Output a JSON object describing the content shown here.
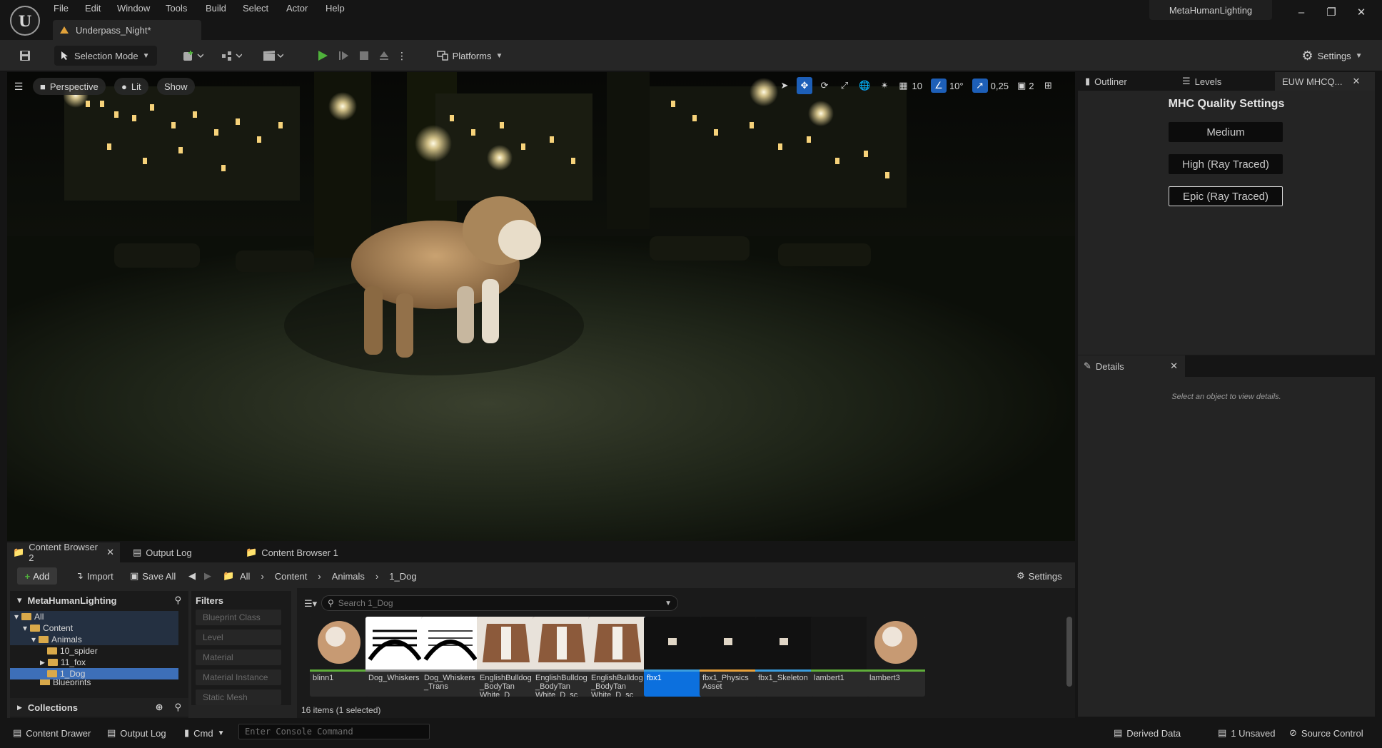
{
  "menu": [
    "File",
    "Edit",
    "Window",
    "Tools",
    "Build",
    "Select",
    "Actor",
    "Help"
  ],
  "doc_tab": {
    "title": "Underpass_Night*"
  },
  "project_name": "MetaHumanLighting",
  "toolbar": {
    "selection_mode": "Selection Mode",
    "platforms": "Platforms",
    "settings": "Settings"
  },
  "viewport": {
    "perspective": "Perspective",
    "lit": "Lit",
    "show": "Show",
    "grid_snap": "10",
    "rotation_snap": "10°",
    "scale_snap": "0,25",
    "camera_speed": "2"
  },
  "right_panel": {
    "tabs": {
      "outliner": "Outliner",
      "levels": "Levels",
      "euw": "EUW MHCQ..."
    },
    "mhc": {
      "title": "MHC Quality Settings",
      "buttons": [
        "Medium",
        "High (Ray Traced)",
        "Epic (Ray Traced)"
      ]
    },
    "details": {
      "tab": "Details",
      "empty_text": "Select an object to view details."
    }
  },
  "content_browser": {
    "tabs": [
      "Content Browser 2",
      "Output Log",
      "Content Browser 1"
    ],
    "toolbar": {
      "add": "Add",
      "import": "Import",
      "save_all": "Save All",
      "settings": "Settings"
    },
    "breadcrumb": [
      "All",
      "Content",
      "Animals",
      "1_Dog"
    ],
    "tree": {
      "root": "MetaHumanLighting",
      "rows": [
        "All",
        "Content",
        "Animals",
        "10_spider",
        "11_fox",
        "1_Dog",
        "Blueprints"
      ]
    },
    "collections": "Collections",
    "filters": {
      "title": "Filters",
      "items": [
        "Blueprint Class",
        "Level",
        "Material",
        "Material Instance",
        "Static Mesh"
      ]
    },
    "search_placeholder": "Search 1_Dog",
    "assets": [
      {
        "label": "blinn1",
        "bar_color": "#5fae3a"
      },
      {
        "label": "Dog_Whiskers",
        "bar_color": "#888888"
      },
      {
        "label": "Dog_Whiskers_Trans",
        "bar_color": "#888888"
      },
      {
        "label": "EnglishBulldog_BodyTan White_D",
        "bar_color": "#888888"
      },
      {
        "label": "EnglishBulldog_BodyTan White_D_sc",
        "bar_color": "#888888"
      },
      {
        "label": "EnglishBulldog_BodyTan White_D_sc",
        "bar_color": "#888888"
      },
      {
        "label": "fbx1",
        "bar_color": "#3a9dde"
      },
      {
        "label": "fbx1_Physics Asset",
        "bar_color": "#e8a13a"
      },
      {
        "label": "fbx1_Skeleton",
        "bar_color": "#3a9dde"
      },
      {
        "label": "lambert1",
        "bar_color": "#5fae3a"
      },
      {
        "label": "lambert3",
        "bar_color": "#5fae3a"
      }
    ],
    "item_count": "16 items (1 selected)"
  },
  "statusbar": {
    "content_drawer": "Content Drawer",
    "output_log": "Output Log",
    "cmd": "Cmd",
    "console_placeholder": "Enter Console Command",
    "derived_data": "Derived Data",
    "unsaved": "1 Unsaved",
    "source_control": "Source Control"
  },
  "colors": {
    "accent_blue": "#0c70de",
    "play_green": "#4fb13b",
    "warning_orange": "#e2a23a"
  }
}
